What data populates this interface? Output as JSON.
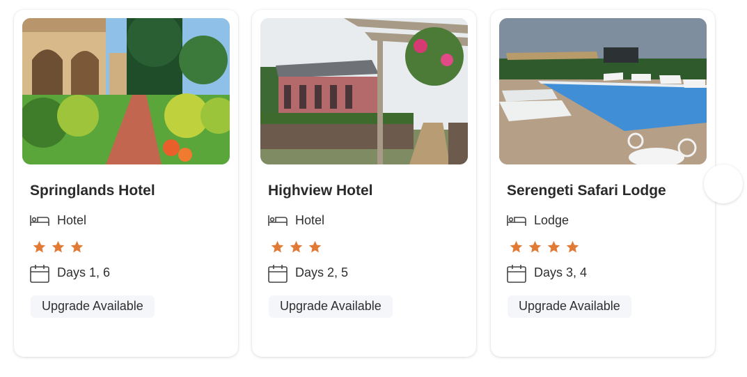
{
  "colors": {
    "star": "#e07a34",
    "badge_bg": "#f4f6f9"
  },
  "cards": [
    {
      "name": "Springlands Hotel",
      "type": "Hotel",
      "type_icon": "bed-icon",
      "stars": 3,
      "days": "Days 1, 6",
      "days_icon": "calendar-icon",
      "badge": "Upgrade Available"
    },
    {
      "name": "Highview Hotel",
      "type": "Hotel",
      "type_icon": "bed-icon",
      "stars": 3,
      "days": "Days 2, 5",
      "days_icon": "calendar-icon",
      "badge": "Upgrade Available"
    },
    {
      "name": "Serengeti Safari Lodge",
      "type": "Lodge",
      "type_icon": "bed-icon",
      "stars": 4,
      "days": "Days 3, 4",
      "days_icon": "calendar-icon",
      "badge": "Upgrade Available"
    }
  ],
  "carousel": {
    "next_icon": "next-arrow-icon"
  }
}
